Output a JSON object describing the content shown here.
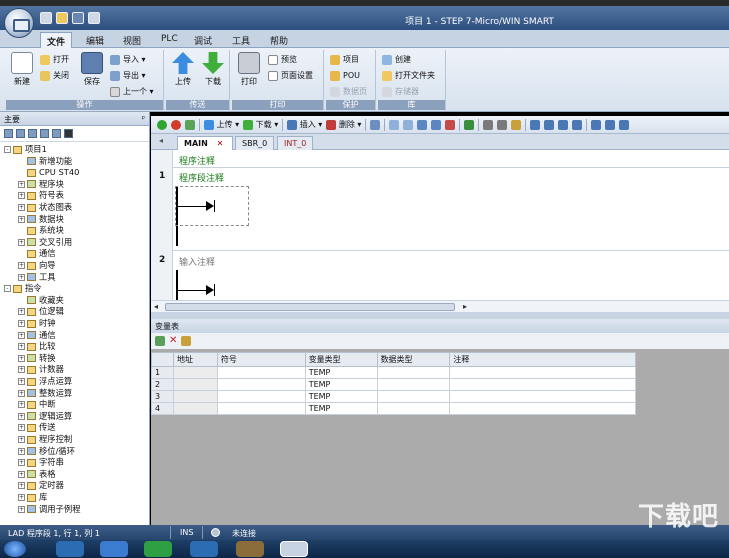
{
  "window": {
    "title": "项目 1 - STEP 7-Micro/WIN SMART"
  },
  "ribbon_tabs": [
    "文件",
    "编辑",
    "视图",
    "PLC",
    "调试",
    "工具",
    "帮助"
  ],
  "ribbon": {
    "new": "新建",
    "open": "打开",
    "close": "关闭",
    "save": "保存",
    "import": "导入",
    "export": "导出",
    "previous": "上一个",
    "group_ops": "操作",
    "upload": "上传",
    "download": "下载",
    "group_transfer": "传送",
    "print": "打印",
    "preview": "预览",
    "page_setup": "页面设置",
    "group_print": "打印",
    "project": "项目",
    "pou": "POU",
    "datapage": "数据页",
    "group_protect": "保护",
    "create": "创建",
    "open_folder": "打开文件夹",
    "memory": "存储器",
    "group_lib": "库"
  },
  "left_panel": {
    "title": "主要",
    "tree": [
      {
        "label": "项目1",
        "level": 0,
        "exp": "-"
      },
      {
        "label": "新增功能",
        "level": 1,
        "exp": ""
      },
      {
        "label": "CPU ST40",
        "level": 1,
        "exp": ""
      },
      {
        "label": "程序块",
        "level": 1,
        "exp": "+"
      },
      {
        "label": "符号表",
        "level": 1,
        "exp": "+"
      },
      {
        "label": "状态图表",
        "level": 1,
        "exp": "+"
      },
      {
        "label": "数据块",
        "level": 1,
        "exp": "+"
      },
      {
        "label": "系统块",
        "level": 1,
        "exp": ""
      },
      {
        "label": "交叉引用",
        "level": 1,
        "exp": "+"
      },
      {
        "label": "通信",
        "level": 1,
        "exp": ""
      },
      {
        "label": "向导",
        "level": 1,
        "exp": "+"
      },
      {
        "label": "工具",
        "level": 1,
        "exp": "+"
      },
      {
        "label": "指令",
        "level": 0,
        "exp": "-"
      },
      {
        "label": "收藏夹",
        "level": 1,
        "exp": ""
      },
      {
        "label": "位逻辑",
        "level": 1,
        "exp": "+"
      },
      {
        "label": "时钟",
        "level": 1,
        "exp": "+"
      },
      {
        "label": "通信",
        "level": 1,
        "exp": "+"
      },
      {
        "label": "比较",
        "level": 1,
        "exp": "+"
      },
      {
        "label": "转换",
        "level": 1,
        "exp": "+"
      },
      {
        "label": "计数器",
        "level": 1,
        "exp": "+"
      },
      {
        "label": "浮点运算",
        "level": 1,
        "exp": "+"
      },
      {
        "label": "整数运算",
        "level": 1,
        "exp": "+"
      },
      {
        "label": "中断",
        "level": 1,
        "exp": "+"
      },
      {
        "label": "逻辑运算",
        "level": 1,
        "exp": "+"
      },
      {
        "label": "传送",
        "level": 1,
        "exp": "+"
      },
      {
        "label": "程序控制",
        "level": 1,
        "exp": "+"
      },
      {
        "label": "移位/循环",
        "level": 1,
        "exp": "+"
      },
      {
        "label": "字符串",
        "level": 1,
        "exp": "+"
      },
      {
        "label": "表格",
        "level": 1,
        "exp": "+"
      },
      {
        "label": "定时器",
        "level": 1,
        "exp": "+"
      },
      {
        "label": "库",
        "level": 1,
        "exp": "+"
      },
      {
        "label": "调用子例程",
        "level": 1,
        "exp": "+"
      }
    ]
  },
  "editor_toolbar": {
    "upload": "上传",
    "download": "下载",
    "insert": "插入",
    "delete": "删除"
  },
  "editor_tabs": {
    "main": "MAIN",
    "sbr": "SBR_0",
    "int": "INT_0"
  },
  "lad": {
    "program_comment": "程序注释",
    "rung1_num": "1",
    "rung1_comment": "程序段注释",
    "rung2_num": "2",
    "rung2_comment": "输入注释"
  },
  "var_table": {
    "title": "变量表",
    "headers": [
      "地址",
      "符号",
      "变量类型",
      "数据类型",
      "注释"
    ],
    "rows": [
      {
        "n": "1",
        "type": "TEMP"
      },
      {
        "n": "2",
        "type": "TEMP"
      },
      {
        "n": "3",
        "type": "TEMP"
      },
      {
        "n": "4",
        "type": "TEMP"
      }
    ]
  },
  "status": {
    "position": "LAD 程序段 1, 行 1, 列 1",
    "mode": "INS",
    "connection": "未连接"
  },
  "watermark": "下载吧"
}
